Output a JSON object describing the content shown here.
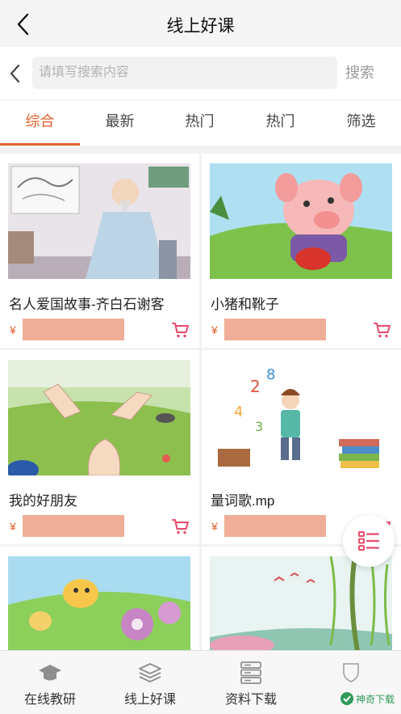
{
  "header": {
    "title": "线上好课",
    "back_icon": "chevron-left-icon"
  },
  "search": {
    "placeholder": "请填写搜索内容",
    "value": "",
    "button_label": "搜索",
    "back_icon": "chevron-left-icon"
  },
  "tabs": [
    {
      "label": "综合",
      "active": true
    },
    {
      "label": "最新",
      "active": false
    },
    {
      "label": "热门",
      "active": false
    },
    {
      "label": "热门",
      "active": false
    },
    {
      "label": "筛选",
      "active": false
    }
  ],
  "courses": [
    {
      "title": "名人爱国故事-齐白石谢客",
      "price_symbol": "¥",
      "thumb": "scholar-painting-illustration"
    },
    {
      "title": "小猪和靴子",
      "price_symbol": "¥",
      "thumb": "pig-with-boot-illustration"
    },
    {
      "title": "我的好朋友",
      "price_symbol": "¥",
      "thumb": "hands-rock-paper-scissors-illustration"
    },
    {
      "title": "量词歌.mp",
      "price_symbol": "¥",
      "thumb": "boy-with-letters-and-books-illustration"
    },
    {
      "title": "",
      "price_symbol": "",
      "thumb": "bees-and-flowers-illustration"
    },
    {
      "title": "",
      "price_symbol": "",
      "thumb": "willow-landscape-illustration"
    }
  ],
  "bottom_nav": [
    {
      "label": "在线教研",
      "icon": "graduation-cap-icon"
    },
    {
      "label": "线上好课",
      "icon": "layers-icon"
    },
    {
      "label": "资料下载",
      "icon": "server-stack-icon"
    },
    {
      "label": "",
      "icon": "shield-icon"
    }
  ],
  "watermark": {
    "text": "神奇下载"
  },
  "colors": {
    "accent": "#e2622e",
    "price_placeholder": "#efae98",
    "cart": "#e84a6a"
  }
}
